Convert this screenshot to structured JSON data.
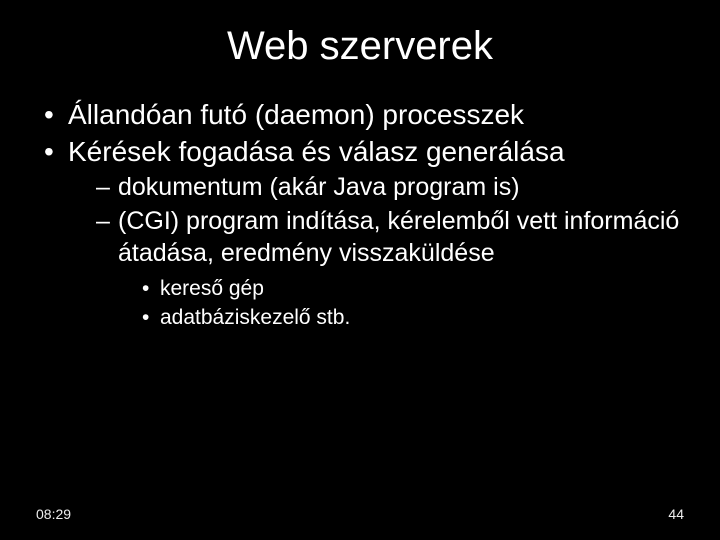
{
  "title": "Web szerverek",
  "bullets": {
    "l1a": "Állandóan futó (daemon) processzek",
    "l1b": "Kérések fogadása és válasz generálása",
    "l2a": "dokumentum (akár Java program is)",
    "l2b": "(CGI) program indítása, kérelemből vett információ átadása, eredmény visszaküldése",
    "l3a": "kereső gép",
    "l3b": "adatbáziskezelő stb."
  },
  "footer": {
    "time": "08:29",
    "page": "44"
  }
}
